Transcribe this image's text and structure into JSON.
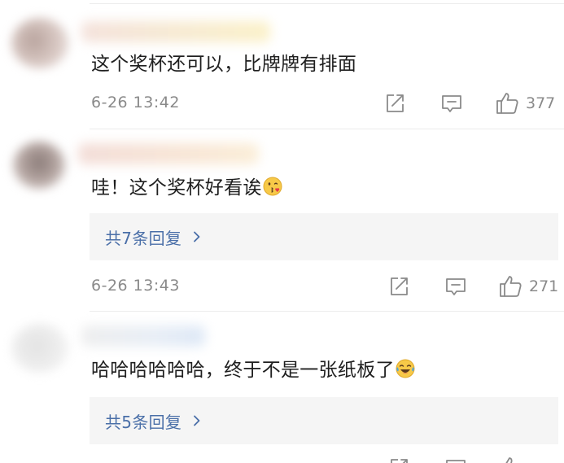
{
  "comments": [
    {
      "text": "这个奖杯还可以，比牌牌有排面",
      "timestamp": "6-26 13:42",
      "likes": "377"
    },
    {
      "text": "哇！这个奖杯好看诶",
      "timestamp": "6-26 13:43",
      "likes": "271",
      "replies_label": "共7条回复"
    },
    {
      "text": "哈哈哈哈哈哈，终于不是一张纸板了",
      "replies_label": "共5条回复"
    }
  ],
  "icons": {
    "share": "share-icon",
    "comment": "comment-icon",
    "like": "thumbs-up-icon",
    "chevron": "chevron-right-icon",
    "emoji_kiss": "kissing-face-emoji",
    "emoji_laugh": "laughing-crying-emoji"
  },
  "colors": {
    "link": "#4a6fa8",
    "meta": "#8a8a8a",
    "reply_bg": "#f5f5f5"
  }
}
